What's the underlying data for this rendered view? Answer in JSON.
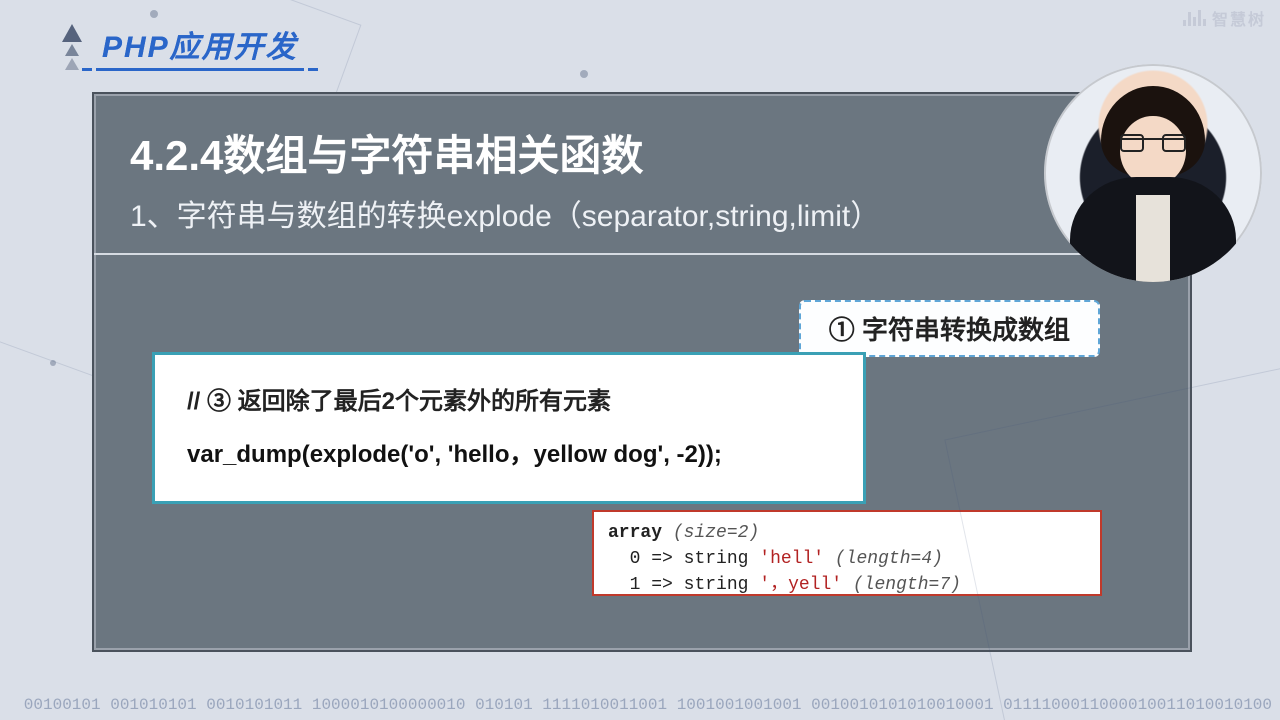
{
  "watermark": {
    "text": "智慧树"
  },
  "course_title": "PHP应用开发",
  "slide": {
    "title": "4.2.4数组与字符串相关函数",
    "subtitle": "1、字符串与数组的转换explode（separator,string,limit）"
  },
  "callout": "① 字符串转换成数组",
  "code": {
    "comment": "// ③ 返回除了最后2个元素外的所有元素",
    "line": "var_dump(explode('o', 'hello，yellow dog', -2));"
  },
  "output": {
    "header_kw": "array",
    "header_it": "(size=2)",
    "rows": [
      {
        "idx": "0",
        "arrow": "=>",
        "type": "string",
        "value": "'hell'",
        "len_it": "(length=4)"
      },
      {
        "idx": "1",
        "arrow": "=>",
        "type": "string",
        "value": "'，yell'",
        "len_it": "(length=7)"
      }
    ]
  },
  "binary_noise": "00100101\n001010101\n0010101011\n1000010100000010\n010101\n1111010011001\n1001001001001\n0010010101010010001\n0111100011000010011010010100"
}
